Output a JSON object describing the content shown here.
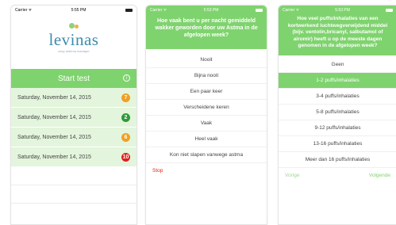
{
  "screen1": {
    "status": {
      "carrier": "Carrier ᯤ",
      "time": "5:55 PM"
    },
    "logo": {
      "name": "levinas",
      "tagline": "easy asthma manager"
    },
    "start_label": "Start test",
    "info_glyph": "i",
    "rows": [
      {
        "date": "Saturday, November 14, 2015",
        "score": "7",
        "color": "#f0a020"
      },
      {
        "date": "Saturday, November 14, 2015",
        "score": "2",
        "color": "#2e9a3a"
      },
      {
        "date": "Saturday, November 14, 2015",
        "score": "6",
        "color": "#f0a020"
      },
      {
        "date": "Saturday, November 14, 2015",
        "score": "10",
        "color": "#e0201a"
      }
    ]
  },
  "screen2": {
    "status": {
      "carrier": "Carrier ᯤ",
      "time": "5:53 PM"
    },
    "question": "Hoe vaak bent u per nacht gemiddeld wakker geworden door uw Astma in de afgelopen week?",
    "options": [
      "Nooit",
      "Bijna nooit",
      "Een paar keer",
      "Verscheidene keren",
      "Vaak",
      "Heel vaak",
      "Kon niet slapen vanwege astma"
    ],
    "stop_label": "Stop"
  },
  "screen3": {
    "status": {
      "carrier": "Carrier ᯤ",
      "time": "5:53 PM"
    },
    "question": "Hoe veel puffs/inhalaties van een kortwerkend luchtwegverwijdend middel (bijv. ventolin,bricanyl, salbutamol of airomir) heeft u op de meeste dagen genomen in de afgelopen week?",
    "options": [
      "Geen",
      "1-2 puffs/inhalaties",
      "3-4 puffs/inhalaties",
      "5-8 puffs/inhalaties",
      "9-12 puffs/inhalaties",
      "13-16 puffs/inhalaties",
      "Meer dan 16 puffs/inhalaties"
    ],
    "selected_index": 1,
    "back_label": "Vorige",
    "next_label": "Volgende"
  },
  "colors": {
    "accent": "#7fd36e",
    "row_bg": "#e3f5dc",
    "stop": "#e2231a"
  }
}
